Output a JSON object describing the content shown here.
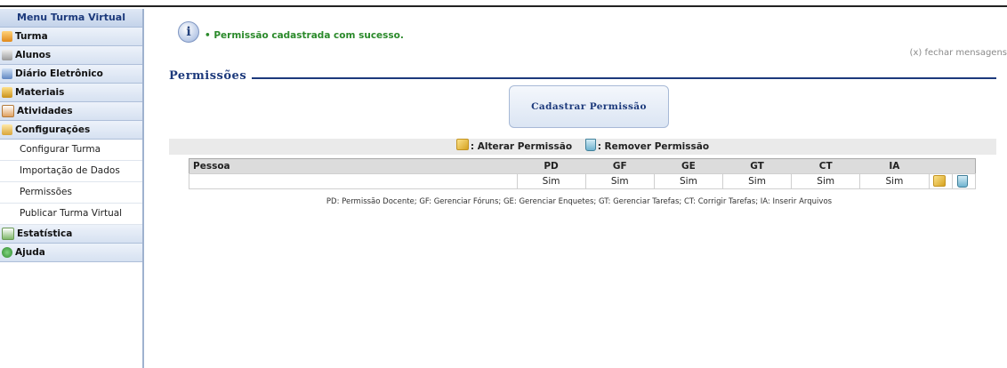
{
  "sidebar": {
    "title": "Menu Turma Virtual",
    "items": [
      {
        "label": "Turma",
        "icon": "people-icon"
      },
      {
        "label": "Alunos",
        "icon": "list-icon"
      },
      {
        "label": "Diário Eletrônico",
        "icon": "book-icon"
      },
      {
        "label": "Materiais",
        "icon": "folder-icon"
      },
      {
        "label": "Atividades",
        "icon": "clipboard-icon"
      },
      {
        "label": "Configurações",
        "icon": "wrench-icon"
      }
    ],
    "subitems": [
      "Configurar Turma",
      "Importação de Dados",
      "Permissões",
      "Publicar Turma Virtual"
    ],
    "bottom_items": [
      {
        "label": "Estatística",
        "icon": "chart-icon"
      },
      {
        "label": "Ajuda",
        "icon": "help-icon"
      }
    ]
  },
  "message": {
    "text": "• Permissão cadastrada com sucesso.",
    "close_label": "(x) fechar mensagens"
  },
  "page": {
    "title": "Permissões",
    "cadastrar_label": "Cadastrar Permissão",
    "legend_alterar": ": Alterar Permissão",
    "legend_remover": ": Remover Permissão"
  },
  "table": {
    "headers": [
      "Pessoa",
      "PD",
      "GF",
      "GE",
      "GT",
      "CT",
      "IA"
    ],
    "rows": [
      {
        "pessoa": "",
        "values": [
          "Sim",
          "Sim",
          "Sim",
          "Sim",
          "Sim",
          "Sim"
        ]
      }
    ]
  },
  "footnote": "PD: Permissão Docente; GF: Gerenciar Fóruns; GE: Gerenciar Enquetes; GT: Gerenciar Tarefas; CT: Corrigir Tarefas; IA: Inserir Arquivos",
  "colors": {
    "accent": "#1d3a7c",
    "success": "#2b8a2b"
  }
}
